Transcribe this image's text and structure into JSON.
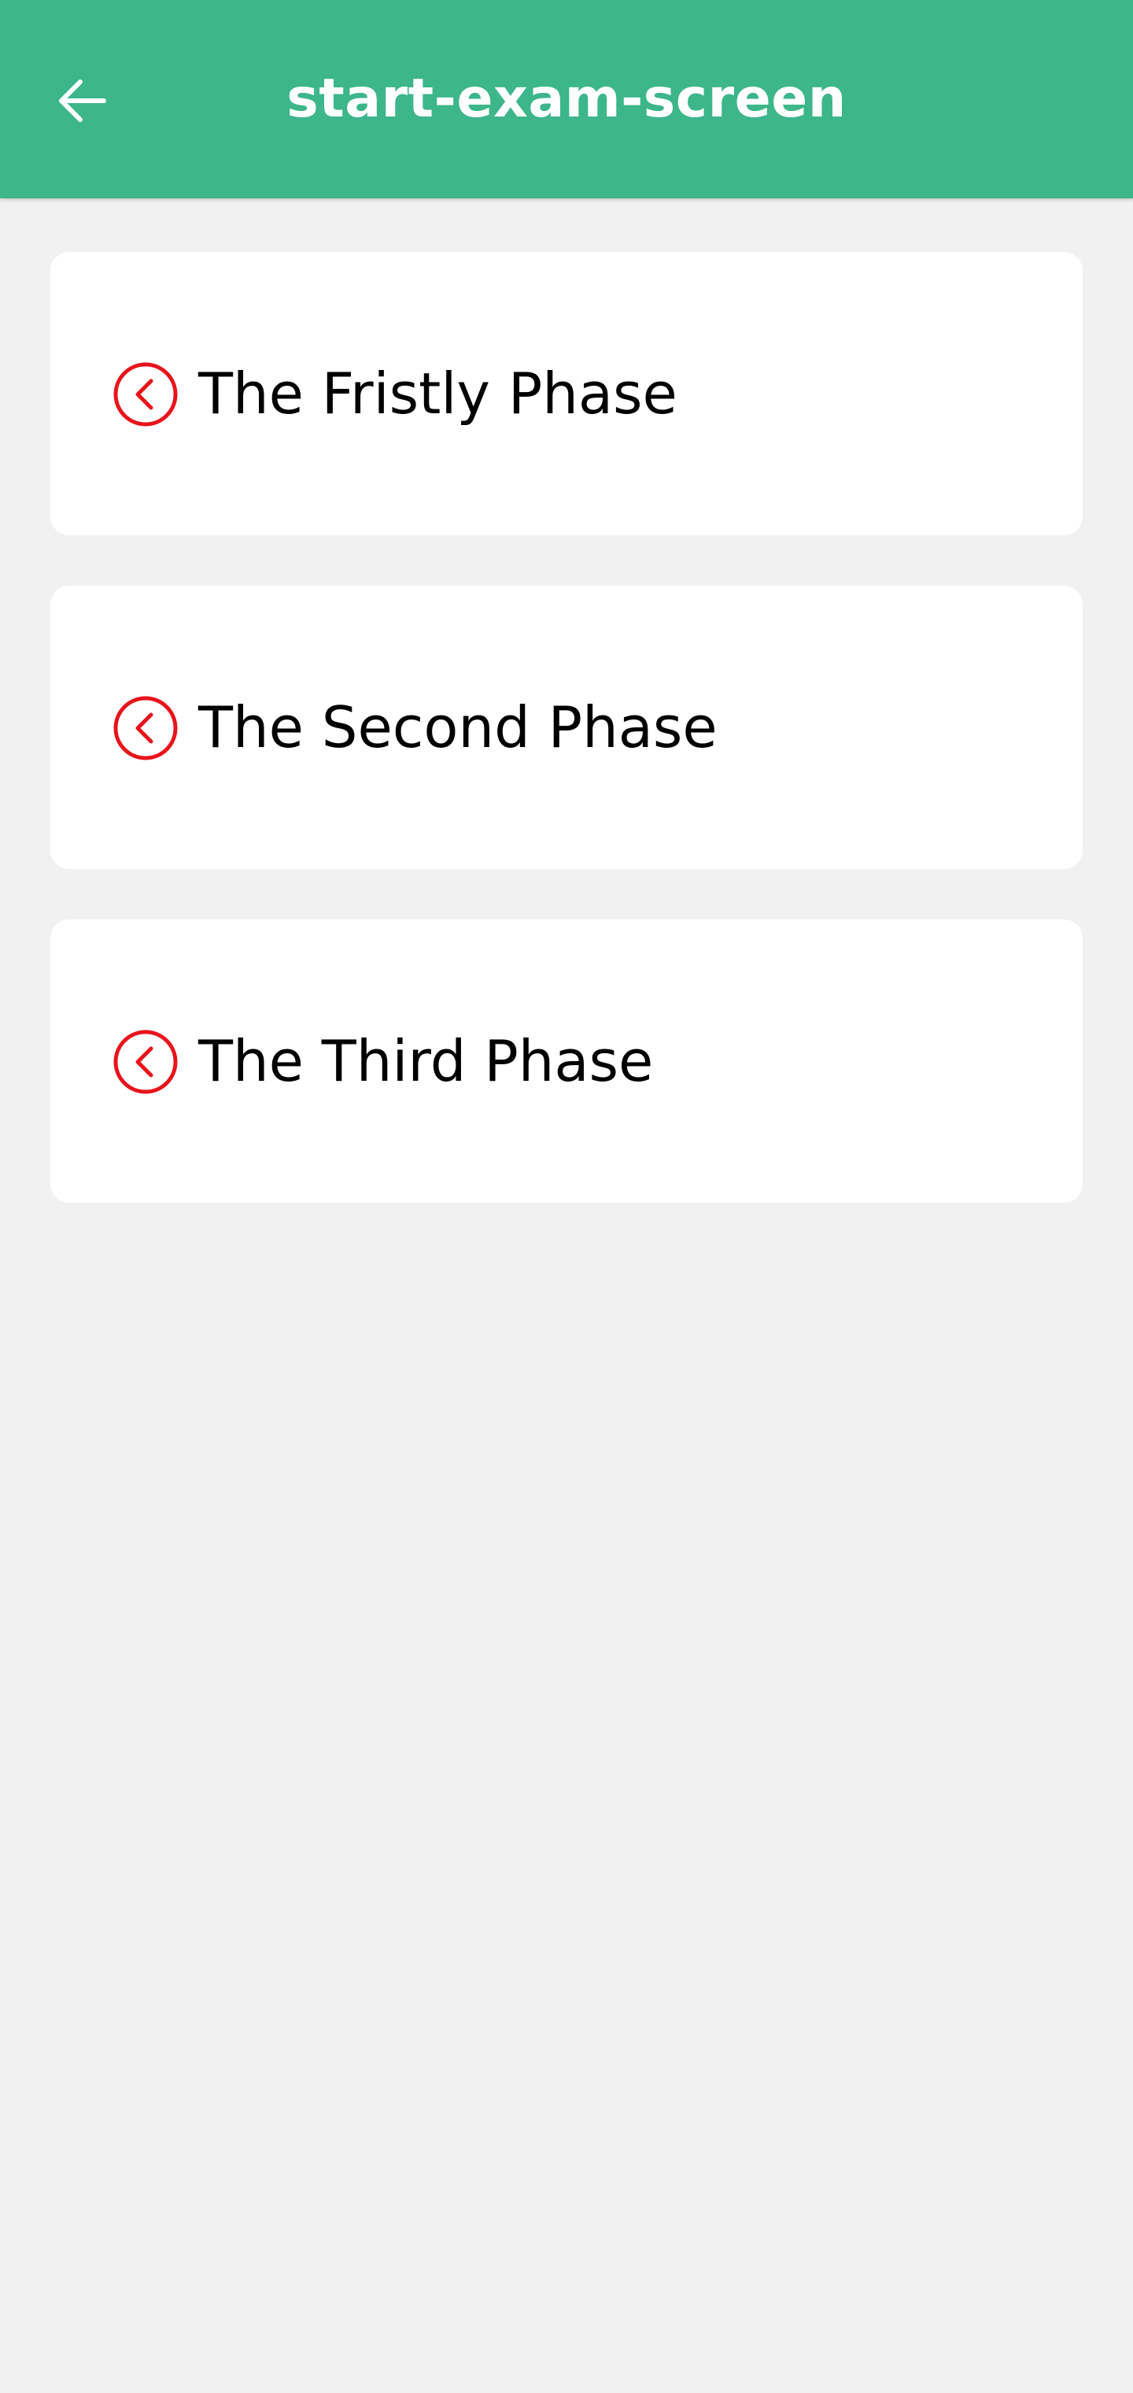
{
  "app_bar": {
    "title": "start-exam-screen",
    "back_icon": "arrow-left-icon",
    "background_color": "#3cb68a"
  },
  "phases": [
    {
      "label": "The Fristly Phase",
      "icon": "chevron-left-circle-icon"
    },
    {
      "label": "The Second Phase",
      "icon": "chevron-left-circle-icon"
    },
    {
      "label": "The Third Phase",
      "icon": "chevron-left-circle-icon"
    }
  ],
  "colors": {
    "icon_accent": "#e8141c",
    "page_background": "#f1f1f1",
    "card_background": "#ffffff"
  }
}
